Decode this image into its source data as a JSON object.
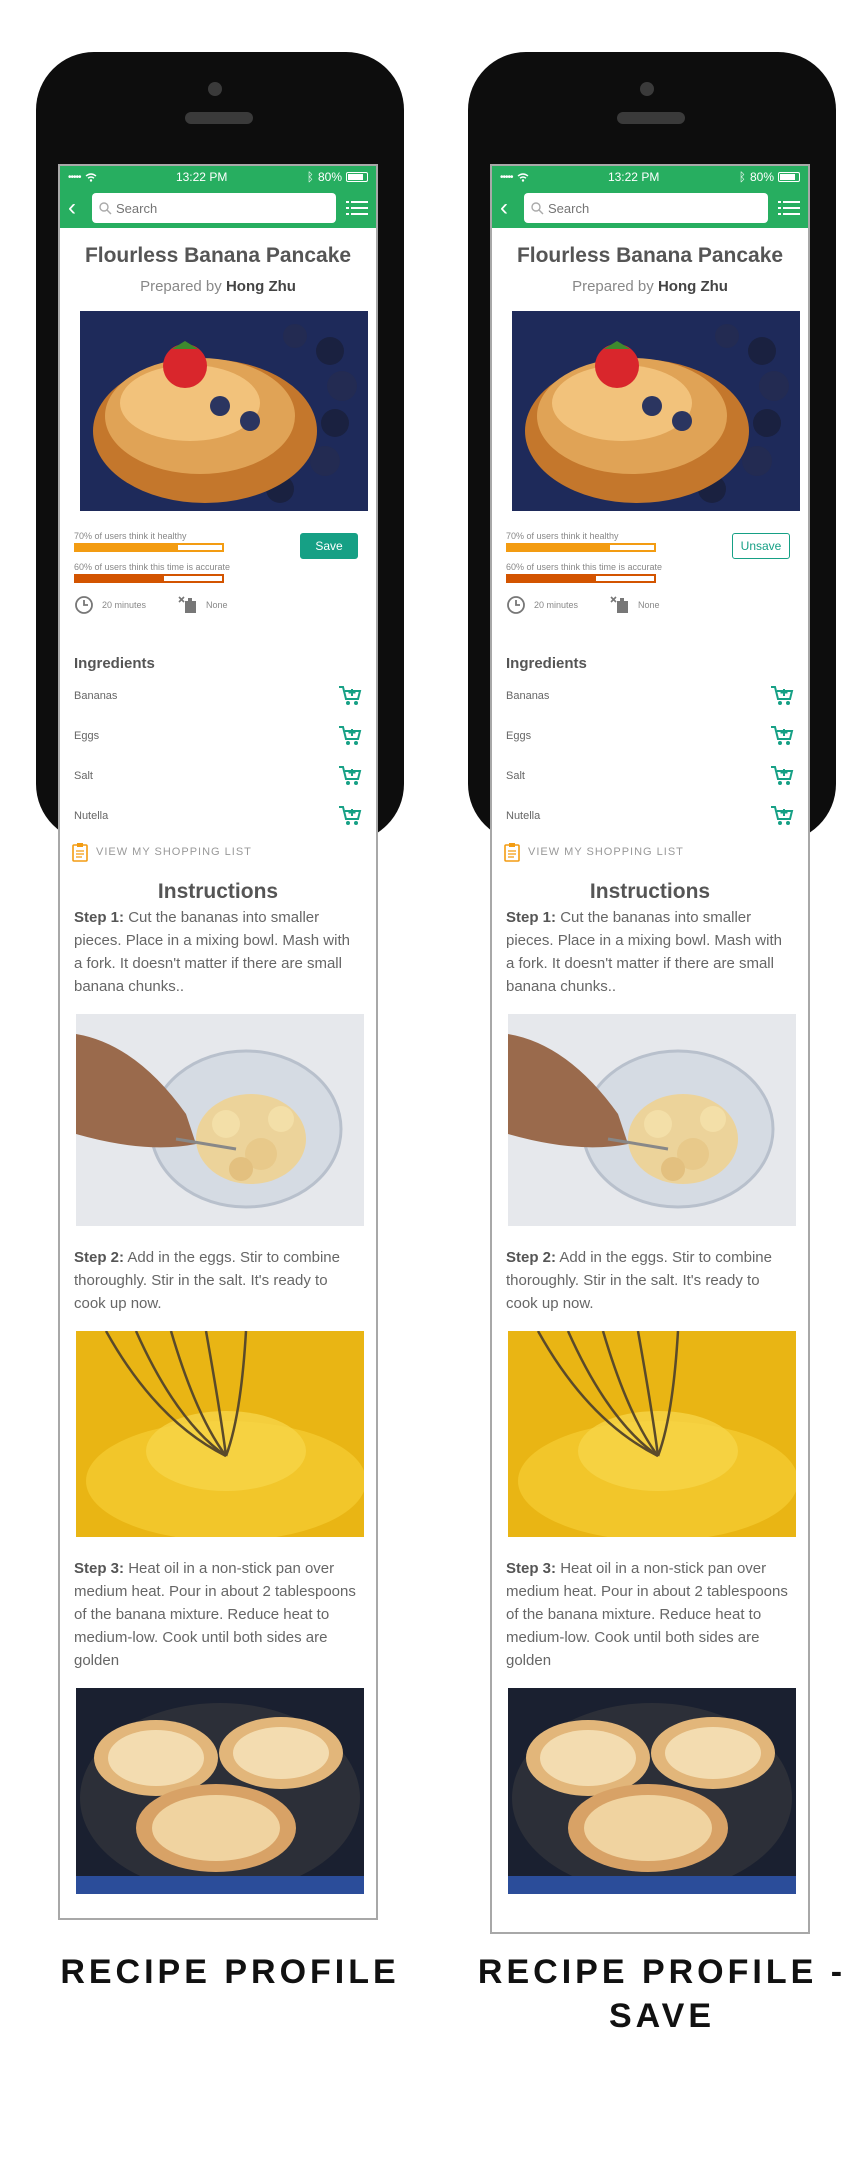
{
  "mockups": [
    {
      "status": {
        "signal": "•••••",
        "time": "13:22 PM",
        "battery": "80%"
      },
      "search": {
        "placeholder": "Search"
      },
      "recipe": {
        "title": "Flourless Banana Pancake",
        "prepared_prefix": "Prepared by",
        "author": "Hong Zhu"
      },
      "ratings": [
        {
          "label": "70% of users think it healthy",
          "value": 0.7
        },
        {
          "label": "60% of users think this time is accurate",
          "value": 0.6
        }
      ],
      "save_button": "Save",
      "time": "20 minutes",
      "allergens": "None",
      "ingredients_title": "Ingredients",
      "ingredients": [
        "Bananas",
        "Eggs",
        "Salt",
        "Nutella"
      ],
      "shopping_link": "VIEW MY SHOPPING LIST",
      "instructions_title": "Instructions",
      "steps": [
        {
          "label": "Step 1:",
          "text": "Cut the bananas into smaller pieces. Place in a mixing bowl. Mash with a fork. It doesn't matter if there are small banana chunks.."
        },
        {
          "label": "Step 2:",
          "text": "Add in the eggs. Stir to combine thoroughly. Stir in the salt. It's ready to cook up now."
        },
        {
          "label": "Step 3:",
          "text": "Heat oil in a non-stick pan over medium heat. Pour in about 2 tablespoons of the banana mixture. Reduce heat to medium-low. Cook until both sides are golden"
        }
      ],
      "caption": "RECIPE PROFILE"
    },
    {
      "status": {
        "signal": "•••••",
        "time": "13:22 PM",
        "battery": "80%"
      },
      "search": {
        "placeholder": "Search"
      },
      "recipe": {
        "title": "Flourless Banana Pancake",
        "prepared_prefix": "Prepared by",
        "author": "Hong Zhu"
      },
      "ratings": [
        {
          "label": "70% of users think it healthy",
          "value": 0.7
        },
        {
          "label": "60% of users think this time is accurate",
          "value": 0.6
        }
      ],
      "save_button": "Unsave",
      "time": "20 minutes",
      "allergens": "None",
      "ingredients_title": "Ingredients",
      "ingredients": [
        "Bananas",
        "Eggs",
        "Salt",
        "Nutella"
      ],
      "shopping_link": "VIEW MY SHOPPING LIST",
      "instructions_title": "Instructions",
      "steps": [
        {
          "label": "Step 1:",
          "text": "Cut the bananas into smaller pieces. Place in a mixing bowl. Mash with a fork. It doesn't matter if there are small banana chunks.."
        },
        {
          "label": "Step 2:",
          "text": "Add in the eggs. Stir to combine thoroughly. Stir in the salt. It's ready to cook up now."
        },
        {
          "label": "Step 3:",
          "text": "Heat oil in a non-stick pan over medium heat. Pour in about 2 tablespoons of the banana mixture. Reduce heat to medium-low. Cook until both sides are golden"
        }
      ],
      "caption": "RECIPE PROFILE - SAVE"
    }
  ],
  "colors": {
    "brand_green": "#27ae60",
    "teal": "#16a085",
    "orange": "#f39c12",
    "dark_orange": "#d35400"
  },
  "icons": [
    "back-icon",
    "search-icon",
    "menu-icon",
    "clock-icon",
    "allergen-icon",
    "cart-icon",
    "clipboard-icon"
  ]
}
